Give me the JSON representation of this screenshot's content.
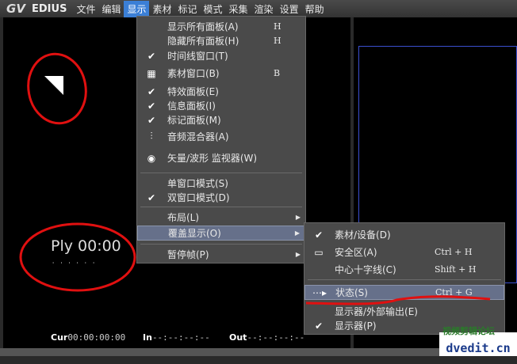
{
  "menubar": {
    "logo": "GV",
    "brand": "EDIUS",
    "items": [
      "文件",
      "编辑",
      "显示",
      "素材",
      "标记",
      "模式",
      "采集",
      "渲染",
      "设置",
      "帮助"
    ],
    "active": "显示"
  },
  "player": {
    "label": "Ply 00:00",
    "cur_label": "Cur",
    "cur": "00:00:00:00",
    "in_label": "In",
    "in": "--:--:--:--",
    "out_label": "Out",
    "out": "--:--:--:--"
  },
  "view_menu": [
    {
      "label": "显示所有面板(A)",
      "shortcut": "H",
      "icon": ""
    },
    {
      "label": "隐藏所有面板(H)",
      "shortcut": "H",
      "icon": ""
    },
    {
      "label": "时间线窗口(T)",
      "checked": true,
      "icon": "check-icon"
    },
    {
      "label": "素材窗口(B)",
      "shortcut": "B",
      "icon": "bin-window-icon"
    },
    {
      "label": "特效面板(E)",
      "checked": true,
      "icon": "check-icon"
    },
    {
      "label": "信息面板(I)",
      "checked": true,
      "icon": "check-icon"
    },
    {
      "label": "标记面板(M)",
      "checked": true,
      "icon": "check-icon"
    },
    {
      "label": "音频混合器(A)",
      "icon": "audio-mixer-icon"
    },
    {
      "label": "矢量/波形 监视器(W)",
      "icon": "vectorscope-icon"
    },
    {
      "label": "单窗口模式(S)"
    },
    {
      "label": "双窗口模式(D)",
      "checked": true,
      "icon": "check-icon"
    },
    {
      "label": "布局(L)",
      "submenu": true
    },
    {
      "label": "覆盖显示(O)",
      "submenu": true,
      "highlighted": true
    },
    {
      "label": "暂停帧(P)",
      "submenu": true
    }
  ],
  "overlay_submenu": [
    {
      "label": "素材/设备(D)",
      "checked": true
    },
    {
      "label": "安全区(A)",
      "shortcut": "Ctrl + H",
      "icon": "safe-area-icon"
    },
    {
      "label": "中心十字线(C)",
      "shortcut": "Shift + H"
    },
    {
      "label": "状态(S)",
      "shortcut": "Ctrl + G",
      "highlighted": true,
      "icon": "status-icon"
    },
    {
      "label": "显示器/外部输出(E)"
    },
    {
      "label": "显示器(P)",
      "checked": true
    }
  ],
  "watermark": {
    "title": "视频剪辑论坛",
    "site": "dvedit.cn",
    "bg_text": "EDIUS"
  },
  "colors": {
    "highlight": "#3b7fd6",
    "annotation": "#e01010",
    "menu_bg": "#4a4a4a"
  }
}
